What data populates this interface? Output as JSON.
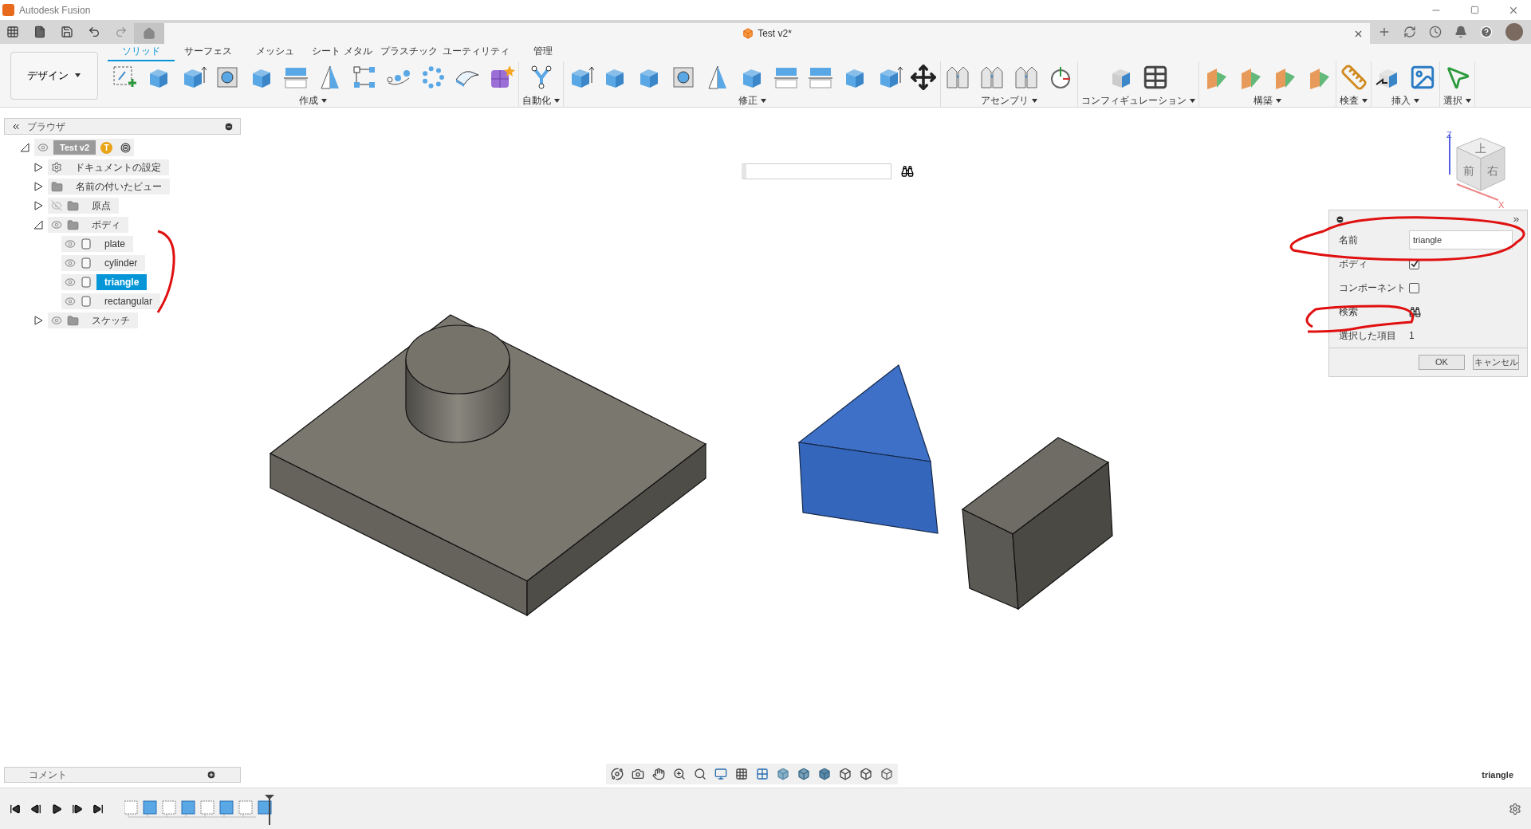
{
  "window": {
    "title": "Autodesk Fusion"
  },
  "document_tab": {
    "title": "Test v2*"
  },
  "workspace": {
    "label": "デザイン"
  },
  "ribbon_tabs": [
    {
      "label": "ソリッド",
      "selected": true
    },
    {
      "label": "サーフェス",
      "selected": false
    },
    {
      "label": "メッシュ",
      "selected": false
    },
    {
      "label": "シート メタル",
      "selected": false
    },
    {
      "label": "プラスチック",
      "selected": false
    },
    {
      "label": "ユーティリティ",
      "selected": false
    },
    {
      "label": "管理",
      "selected": false
    }
  ],
  "panels": [
    {
      "label": "作成"
    },
    {
      "label": "自動化"
    },
    {
      "label": "修正"
    },
    {
      "label": "アセンブリ"
    },
    {
      "label": "コンフィギュレーション"
    },
    {
      "label": "構築"
    },
    {
      "label": "検査"
    },
    {
      "label": "挿入"
    },
    {
      "label": "選択"
    }
  ],
  "browser": {
    "title": "ブラウザ",
    "root": {
      "label": "Test v2",
      "badge": "T",
      "expanded": true,
      "visible": true,
      "children": [
        {
          "kind": "settings",
          "label": "ドキュメントの設定",
          "expanded": false
        },
        {
          "kind": "folder",
          "label": "名前の付いたビュー",
          "expanded": false
        },
        {
          "kind": "folder",
          "label": "原点",
          "expanded": false,
          "visible": false
        },
        {
          "kind": "folder",
          "label": "ボディ",
          "expanded": true,
          "visible": true,
          "children": [
            {
              "kind": "body",
              "label": "plate",
              "visible": true,
              "selected": false
            },
            {
              "kind": "body",
              "label": "cylinder",
              "visible": true,
              "selected": false
            },
            {
              "kind": "body",
              "label": "triangle",
              "visible": true,
              "selected": true
            },
            {
              "kind": "body",
              "label": "rectangular",
              "visible": true,
              "selected": false
            }
          ]
        },
        {
          "kind": "folder",
          "label": "スケッチ",
          "expanded": false,
          "visible": true
        }
      ]
    }
  },
  "viewcube": {
    "top": "上",
    "front": "前",
    "right": "右",
    "z_axis": "Z",
    "x_axis": "X"
  },
  "dialog": {
    "name_label": "名前",
    "name_value": "triangle",
    "body_label": "ボディ",
    "body_checked": true,
    "component_label": "コンポーネント",
    "component_checked": false,
    "search_label": "検索",
    "selected_label": "選択した項目",
    "selected_count": "1",
    "buttons": [
      "OK",
      "キャンセル"
    ]
  },
  "comments": {
    "title": "コメント"
  },
  "status": {
    "selection": "triangle"
  }
}
